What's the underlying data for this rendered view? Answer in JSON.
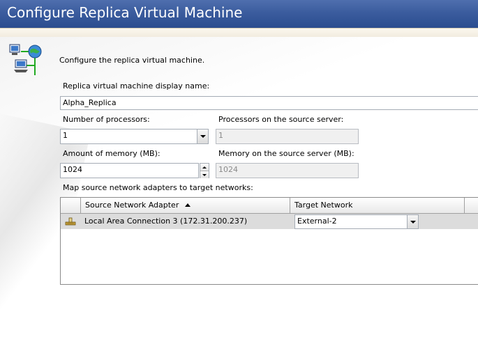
{
  "window": {
    "title": "Configure Replica Virtual Machine"
  },
  "intro": {
    "text": "Configure the replica virtual machine."
  },
  "fields": {
    "display_name": {
      "label": "Replica virtual machine display name:",
      "value": "Alpha_Replica"
    },
    "processors": {
      "label": "Number of processors:",
      "value": "1"
    },
    "source_processors": {
      "label": "Processors on the source server:",
      "value": "1"
    },
    "memory": {
      "label": "Amount of memory (MB):",
      "value": "1024"
    },
    "source_memory": {
      "label": "Memory on the source server (MB):",
      "value": "1024"
    }
  },
  "network_map": {
    "label": "Map source network adapters to target networks:",
    "columns": [
      "Source Network Adapter",
      "Target Network"
    ],
    "sort_indicator": "ascending",
    "rows": [
      {
        "icon": "network-adapter-icon",
        "adapter": "Local Area Connection 3 (172.31.200.237)",
        "target": "External-2"
      }
    ]
  },
  "icons": {
    "header_graphic": "network-globe-icon"
  },
  "colors": {
    "header_blue": "#3b5c9e",
    "header_text": "#ffffff",
    "row_selected": "#dcdcdc"
  }
}
